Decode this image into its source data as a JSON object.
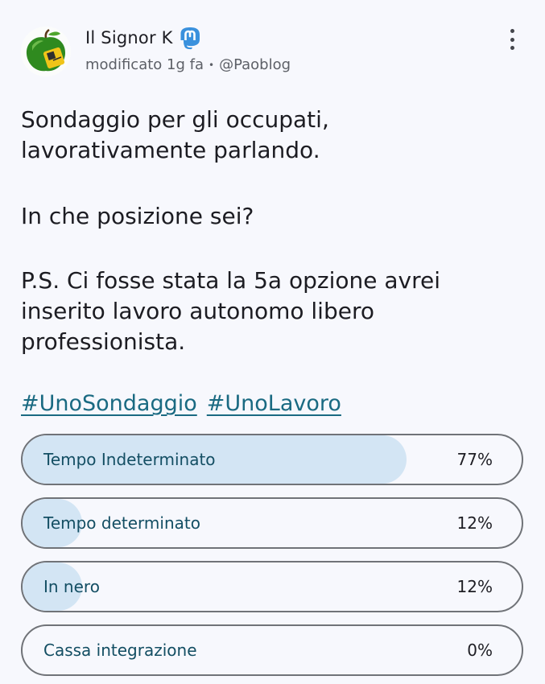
{
  "post": {
    "author_name": "Il Signor K",
    "meta": {
      "edited": "modificato 1g fa",
      "handle": "@Paoblog"
    },
    "body": {
      "paragraph1_line1": "Sondaggio per gli occupati,",
      "paragraph1_line2": "lavorativamente parlando.",
      "paragraph2": "In che posizione sei?",
      "paragraph3_line1": "P.S. Ci fosse stata la 5a opzione avrei",
      "paragraph3_line2": "inserito lavoro autonomo libero",
      "paragraph3_line3": "professionista."
    },
    "hashtags": [
      "#UnoSondaggio",
      "#UnoLavoro"
    ],
    "poll": {
      "options": [
        {
          "label": "Tempo Indeterminato",
          "percent_text": "77%",
          "percent": 77
        },
        {
          "label": "Tempo determinato",
          "percent_text": "12%",
          "percent": 12
        },
        {
          "label": "In nero",
          "percent_text": "12%",
          "percent": 12
        },
        {
          "label": "Cassa integrazione",
          "percent_text": "0%",
          "percent": 0
        }
      ]
    }
  },
  "icons": {
    "avatar": "green-apple-avatar",
    "badge": "mastodon-icon",
    "more": "more-vertical-icon"
  },
  "colors": {
    "background": "#f7f8fd",
    "hashtag": "#1a6a82",
    "poll_fill": "#d3e5f4",
    "mastodon": "#3a91dd"
  }
}
